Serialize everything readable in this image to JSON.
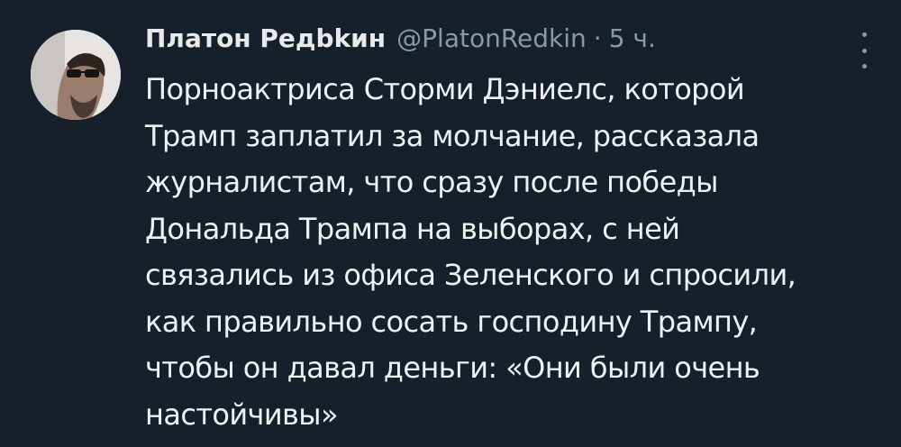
{
  "tweet": {
    "author_name": "Платон Редbkин",
    "author_handle": "@PlatonRedkin",
    "separator": "·",
    "time": "5 ч.",
    "text_lines": [
      "Порноактриса Сторми Дэниелс, которой",
      "Трамп заплатил за молчание, рассказала",
      "журналистам, что сразу после победы",
      "Дональда Трампа на выборах, с ней",
      "связались из офиса Зеленского и спросили,",
      "как правильно сосать господину Трампу,",
      "чтобы он давал деньги: «Они были очень",
      "настойчивы»"
    ]
  },
  "icons": {
    "more": "more-vertical-icon",
    "avatar": "avatar-photo"
  },
  "colors": {
    "background": "#15202b",
    "primary_text": "#e7e9ea",
    "secondary_text": "#8b98a5"
  }
}
